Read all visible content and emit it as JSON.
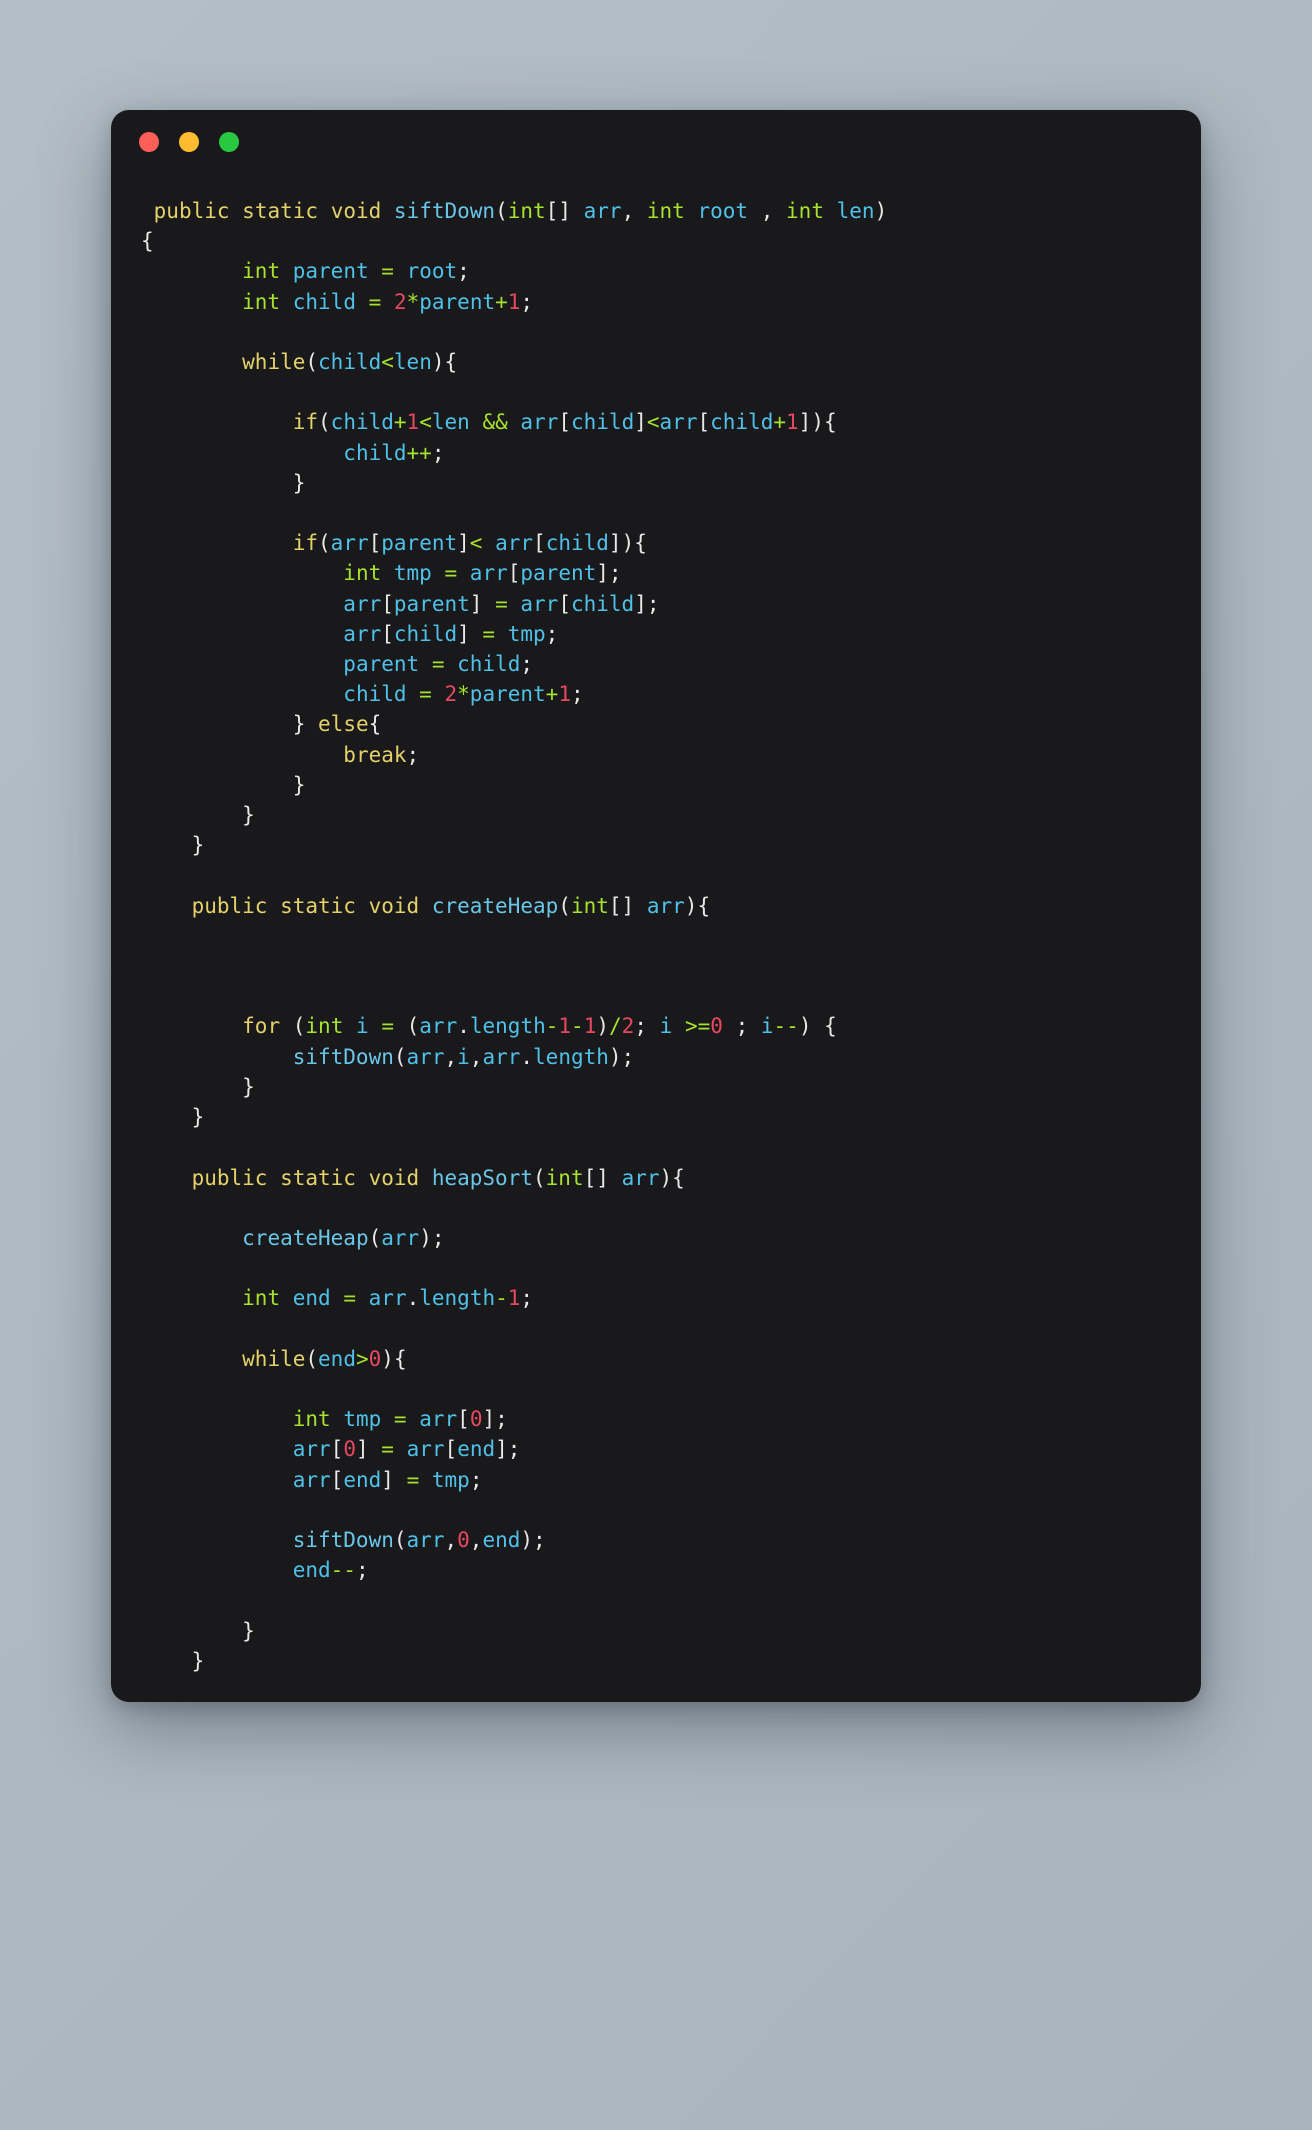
{
  "window": {
    "traffic_lights": [
      {
        "name": "close",
        "color": "#ff5f57"
      },
      {
        "name": "minimize",
        "color": "#febc2e"
      },
      {
        "name": "maximize",
        "color": "#28c840"
      }
    ]
  },
  "theme": {
    "background": "#adb8c0",
    "window_background": "#19191b",
    "keyword": "#e4d16a",
    "type": "#a6e22e",
    "function": "#69c6e8",
    "identifier": "#4fc1e9",
    "number": "#e8485f",
    "operator": "#a6e22e",
    "punctuation": "#e8e8e8"
  },
  "code": {
    "language": "java",
    "lines": [
      " public static void siftDown(int[] arr, int root , int len)",
      "{",
      "        int parent = root;",
      "        int child = 2*parent+1;",
      "",
      "        while(child<len){",
      "",
      "            if(child+1<len && arr[child]<arr[child+1]){",
      "                child++;",
      "            }",
      "",
      "            if(arr[parent]< arr[child]){",
      "                int tmp = arr[parent];",
      "                arr[parent] = arr[child];",
      "                arr[child] = tmp;",
      "                parent = child;",
      "                child = 2*parent+1;",
      "            } else{",
      "                break;",
      "            }",
      "        }",
      "    }",
      "",
      "    public static void createHeap(int[] arr){",
      "",
      "",
      "",
      "        for (int i = (arr.length-1-1)/2; i >=0 ; i--) {",
      "            siftDown(arr,i,arr.length);",
      "        }",
      "    }",
      "",
      "    public static void heapSort(int[] arr){",
      "",
      "        createHeap(arr);",
      "",
      "        int end = arr.length-1;",
      "",
      "        while(end>0){",
      "",
      "            int tmp = arr[0];",
      "            arr[0] = arr[end];",
      "            arr[end] = tmp;",
      "",
      "            siftDown(arr,0,end);",
      "            end--;",
      "",
      "        }",
      "    }"
    ]
  }
}
